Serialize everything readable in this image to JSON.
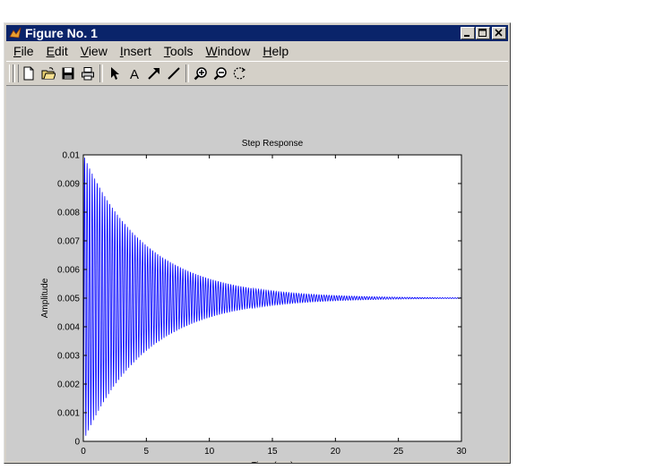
{
  "window": {
    "title": "Figure No. 1"
  },
  "menu": {
    "items": [
      {
        "prefix": "",
        "accel": "F",
        "rest": "ile"
      },
      {
        "prefix": "",
        "accel": "E",
        "rest": "dit"
      },
      {
        "prefix": "",
        "accel": "V",
        "rest": "iew"
      },
      {
        "prefix": "",
        "accel": "I",
        "rest": "nsert"
      },
      {
        "prefix": "",
        "accel": "T",
        "rest": "ools"
      },
      {
        "prefix": "",
        "accel": "W",
        "rest": "indow"
      },
      {
        "prefix": "",
        "accel": "H",
        "rest": "elp"
      }
    ]
  },
  "toolbar": {
    "tools": [
      "new-file-icon",
      "open-folder-icon",
      "save-disk-icon",
      "print-icon",
      "select-arrow-icon",
      "text-a-icon",
      "arrow-draw-icon",
      "line-draw-icon",
      "zoom-in-icon",
      "zoom-out-icon",
      "rotate-3d-icon"
    ]
  },
  "colors": {
    "titlebar": "#0a246a",
    "line": "#0000ff",
    "figure_bg": "#cccccc"
  },
  "chart_data": {
    "type": "line",
    "title": "Step Response",
    "xlabel": "Time (sec)",
    "ylabel": "Amplitude",
    "xlim": [
      0,
      30
    ],
    "ylim": [
      0,
      0.01
    ],
    "xticks": [
      "0",
      "5",
      "10",
      "15",
      "20",
      "25",
      "30"
    ],
    "yticks": [
      "0",
      "0.001",
      "0.002",
      "0.003",
      "0.004",
      "0.005",
      "0.006",
      "0.007",
      "0.008",
      "0.009",
      "0.01"
    ],
    "series": [
      {
        "steady_state": 0.005,
        "peak": 0.01,
        "decay_time_constant": 5,
        "oscillation_frequency_hz": 5
      }
    ]
  }
}
